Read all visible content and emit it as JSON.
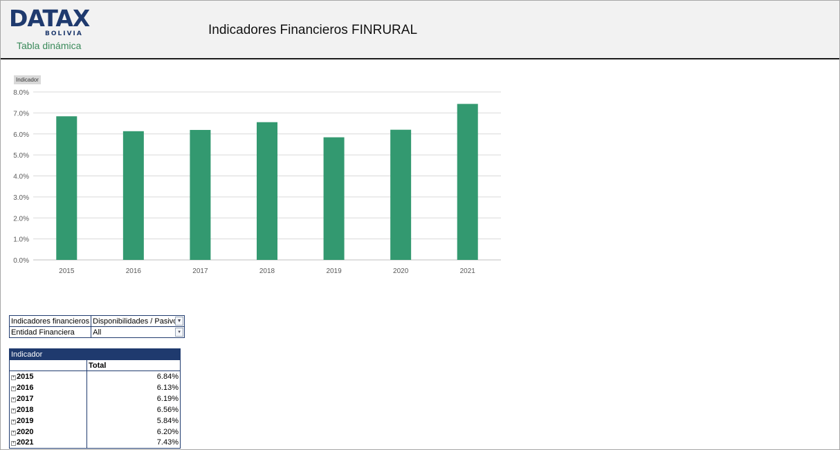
{
  "header": {
    "logo_main": "DATAX",
    "logo_sub": "BOLIVIA",
    "logo_tagline": "Tabla dinámica",
    "title": "Indicadores Financieros FINRURAL"
  },
  "chart_tag": "Indicador",
  "chart_data": {
    "type": "bar",
    "categories": [
      "2015",
      "2016",
      "2017",
      "2018",
      "2019",
      "2020",
      "2021"
    ],
    "values": [
      6.84,
      6.13,
      6.19,
      6.56,
      5.84,
      6.2,
      7.43
    ],
    "ylim": [
      0,
      8
    ],
    "yticks": [
      "0.0%",
      "1.0%",
      "2.0%",
      "3.0%",
      "4.0%",
      "5.0%",
      "6.0%",
      "7.0%",
      "8.0%"
    ],
    "grid": true,
    "bar_color": "#339970"
  },
  "filters": [
    {
      "label": "Indicadores financieros",
      "value": "Disponibilidades / Pasivo",
      "icon": "filter-dropdown-icon"
    },
    {
      "label": "Entidad Financiera",
      "value": "All",
      "icon": "dropdown-arrow-icon"
    }
  ],
  "pivot": {
    "header": "Indicador",
    "total_label": "Total",
    "rows": [
      {
        "year": "2015",
        "value": "6.84%"
      },
      {
        "year": "2016",
        "value": "6.13%"
      },
      {
        "year": "2017",
        "value": "6.19%"
      },
      {
        "year": "2018",
        "value": "6.56%"
      },
      {
        "year": "2019",
        "value": "5.84%"
      },
      {
        "year": "2020",
        "value": "6.20%"
      },
      {
        "year": "2021",
        "value": "7.43%"
      }
    ]
  },
  "colors": {
    "brand": "#1f3a6e",
    "tagline": "#3a8a5a",
    "bar": "#339970"
  }
}
